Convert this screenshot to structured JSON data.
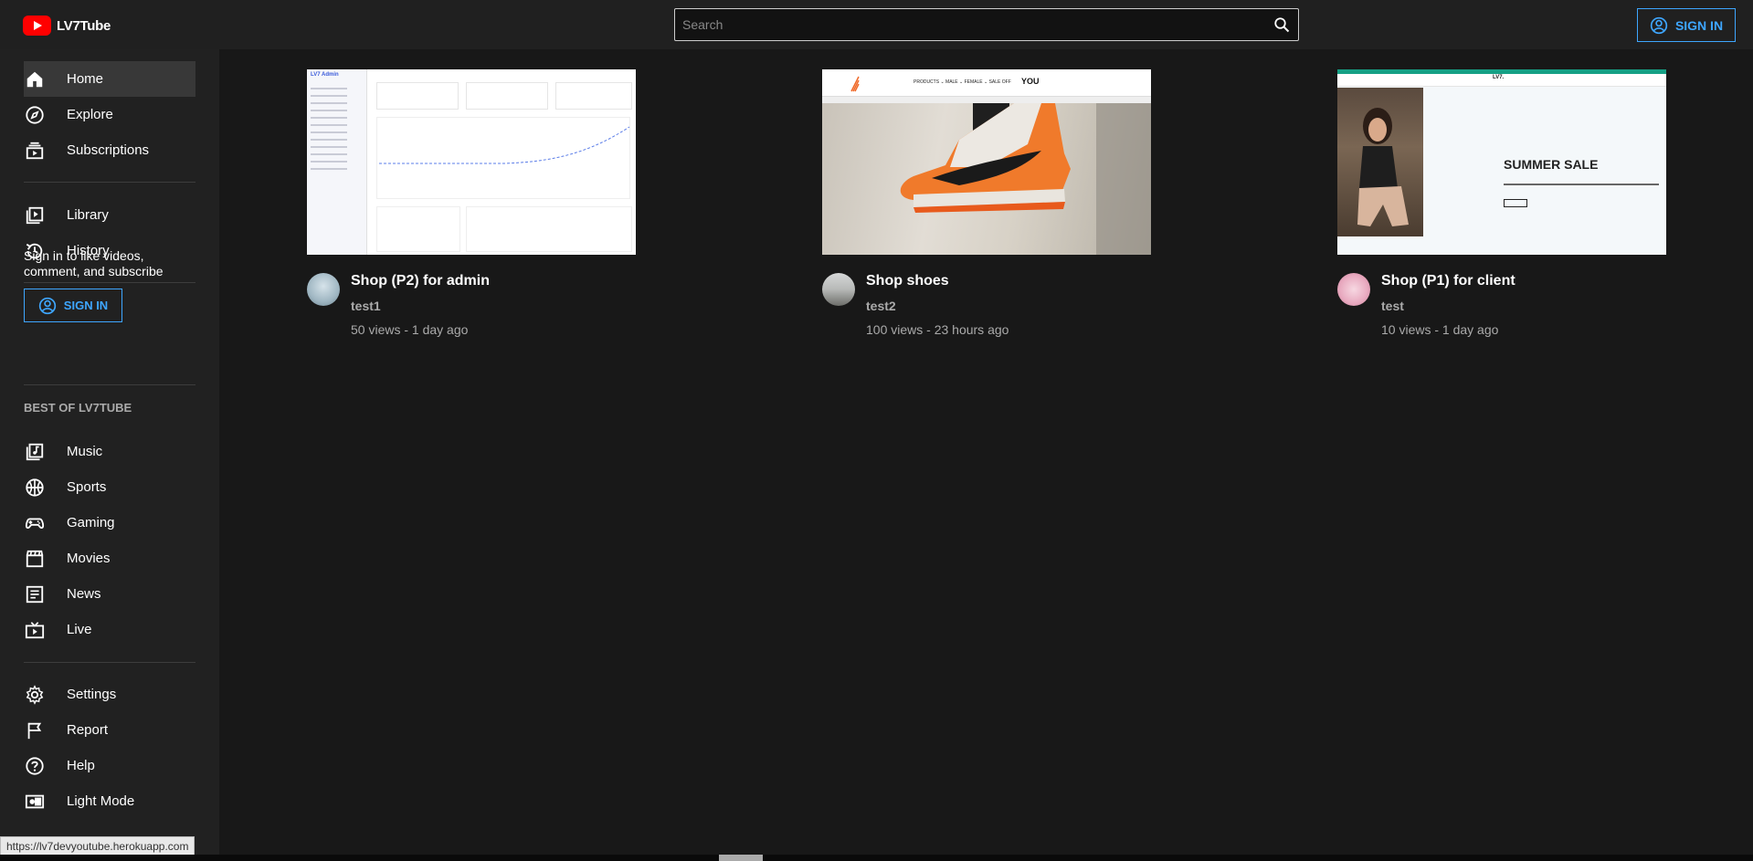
{
  "header": {
    "logo_text": "LV7Tube",
    "search_placeholder": "Search",
    "signin_label": "SIGN IN"
  },
  "sidebar": {
    "primary": [
      {
        "label": "Home",
        "icon": "home-icon"
      },
      {
        "label": "Explore",
        "icon": "compass-icon"
      },
      {
        "label": "Subscriptions",
        "icon": "subscriptions-icon"
      }
    ],
    "secondary": [
      {
        "label": "Library",
        "icon": "library-icon"
      },
      {
        "label": "History",
        "icon": "history-icon"
      }
    ],
    "signin_prompt": "Sign in to like videos, comment, and subscribe",
    "signin_label": "SIGN IN",
    "best_of_title": "BEST OF LV7TUBE",
    "best_of": [
      {
        "label": "Music",
        "icon": "music-icon"
      },
      {
        "label": "Sports",
        "icon": "sports-icon"
      },
      {
        "label": "Gaming",
        "icon": "gamepad-icon"
      },
      {
        "label": "Movies",
        "icon": "movies-icon"
      },
      {
        "label": "News",
        "icon": "news-icon"
      },
      {
        "label": "Live",
        "icon": "live-icon"
      }
    ],
    "footer": [
      {
        "label": "Settings",
        "icon": "gear-icon"
      },
      {
        "label": "Report",
        "icon": "flag-icon"
      },
      {
        "label": "Help",
        "icon": "help-icon"
      },
      {
        "label": "Light Mode",
        "icon": "light-mode-icon"
      }
    ]
  },
  "videos": [
    {
      "title": "Shop (P2) for admin",
      "channel": "test1",
      "stats": "50 views - 1 day ago",
      "thumb_brand": "LV7 Admin"
    },
    {
      "title": "Shop shoes",
      "channel": "test2",
      "stats": "100 views - 23 hours ago",
      "thumb_nav": "PRODUCTS ⌄   MALE ⌄   FEMALE ⌄   SALE OFF",
      "thumb_brand": "YOU"
    },
    {
      "title": "Shop (P1) for client",
      "channel": "test",
      "stats": "10 views - 1 day ago",
      "thumb_brand": "LV7.",
      "thumb_headline": "SUMMER SALE"
    }
  ],
  "statusbar": {
    "url": "https://lv7devyoutube.herokuapp.com"
  },
  "colors": {
    "accent": "#3ea6ff",
    "logo_red": "#ff0000",
    "background": "#181818",
    "sidebar": "#212121"
  }
}
